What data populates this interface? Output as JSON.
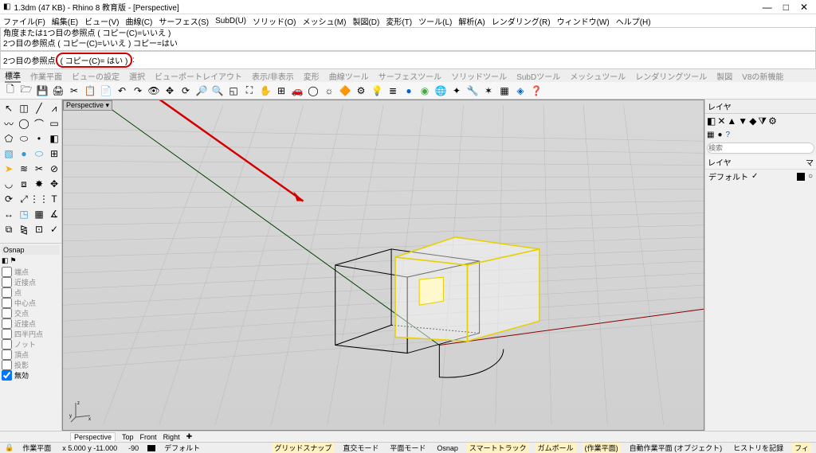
{
  "title": "1.3dm (47 KB) - Rhino 8 教育版 - [Perspective]",
  "menus": [
    "ファイル(F)",
    "編集(E)",
    "ビュー(V)",
    "曲線(C)",
    "サーフェス(S)",
    "SubD(U)",
    "ソリッド(O)",
    "メッシュ(M)",
    "製図(D)",
    "変形(T)",
    "ツール(L)",
    "解析(A)",
    "レンダリング(R)",
    "ウィンドウ(W)",
    "ヘルプ(H)"
  ],
  "cmd_history": [
    "角度または1つ目の参照点 ( コピー(C)=いいえ )",
    "2つ目の参照点 ( コピー(C)=いいえ ) コピー=はい"
  ],
  "cmd_prompt_prefix": "2つ目の参照点",
  "cmd_prompt_circled": "( コピー(C)= はい )",
  "tabs": [
    "標準",
    "作業平面",
    "ビューの設定",
    "選択",
    "ビューポートレイアウト",
    "表示/非表示",
    "変形",
    "曲線ツール",
    "サーフェスツール",
    "ソリッドツール",
    "SubDツール",
    "メッシュツール",
    "レンダリングツール",
    "製図",
    "V8の新機能"
  ],
  "viewport_label": "Perspective ▾",
  "osnap": {
    "title": "Osnap",
    "items": [
      "端点",
      "近接点",
      "点",
      "中心点",
      "交点",
      "近接点",
      "四半円点",
      "ノット",
      "頂点",
      "投影",
      "無効"
    ]
  },
  "right": {
    "title": "レイヤ",
    "search_ph": "検索",
    "cols": {
      "name": "レイヤ",
      "mat": "マ"
    },
    "default_layer": "デフォルト"
  },
  "vptabs": [
    "Perspective",
    "Top",
    "Front",
    "Right"
  ],
  "status": {
    "wp": "作業平面",
    "coords": "x 5.000   y -11.000",
    "z": "-90",
    "layer": "デフォルト",
    "items": [
      "グリッドスナップ",
      "直交モード",
      "平面モード",
      "Osnap",
      "スマートトラック",
      "ガムボール",
      "(作業平面)",
      "自動作業平面 (オブジェクト)",
      "ヒストリを記録",
      "フィ"
    ]
  }
}
